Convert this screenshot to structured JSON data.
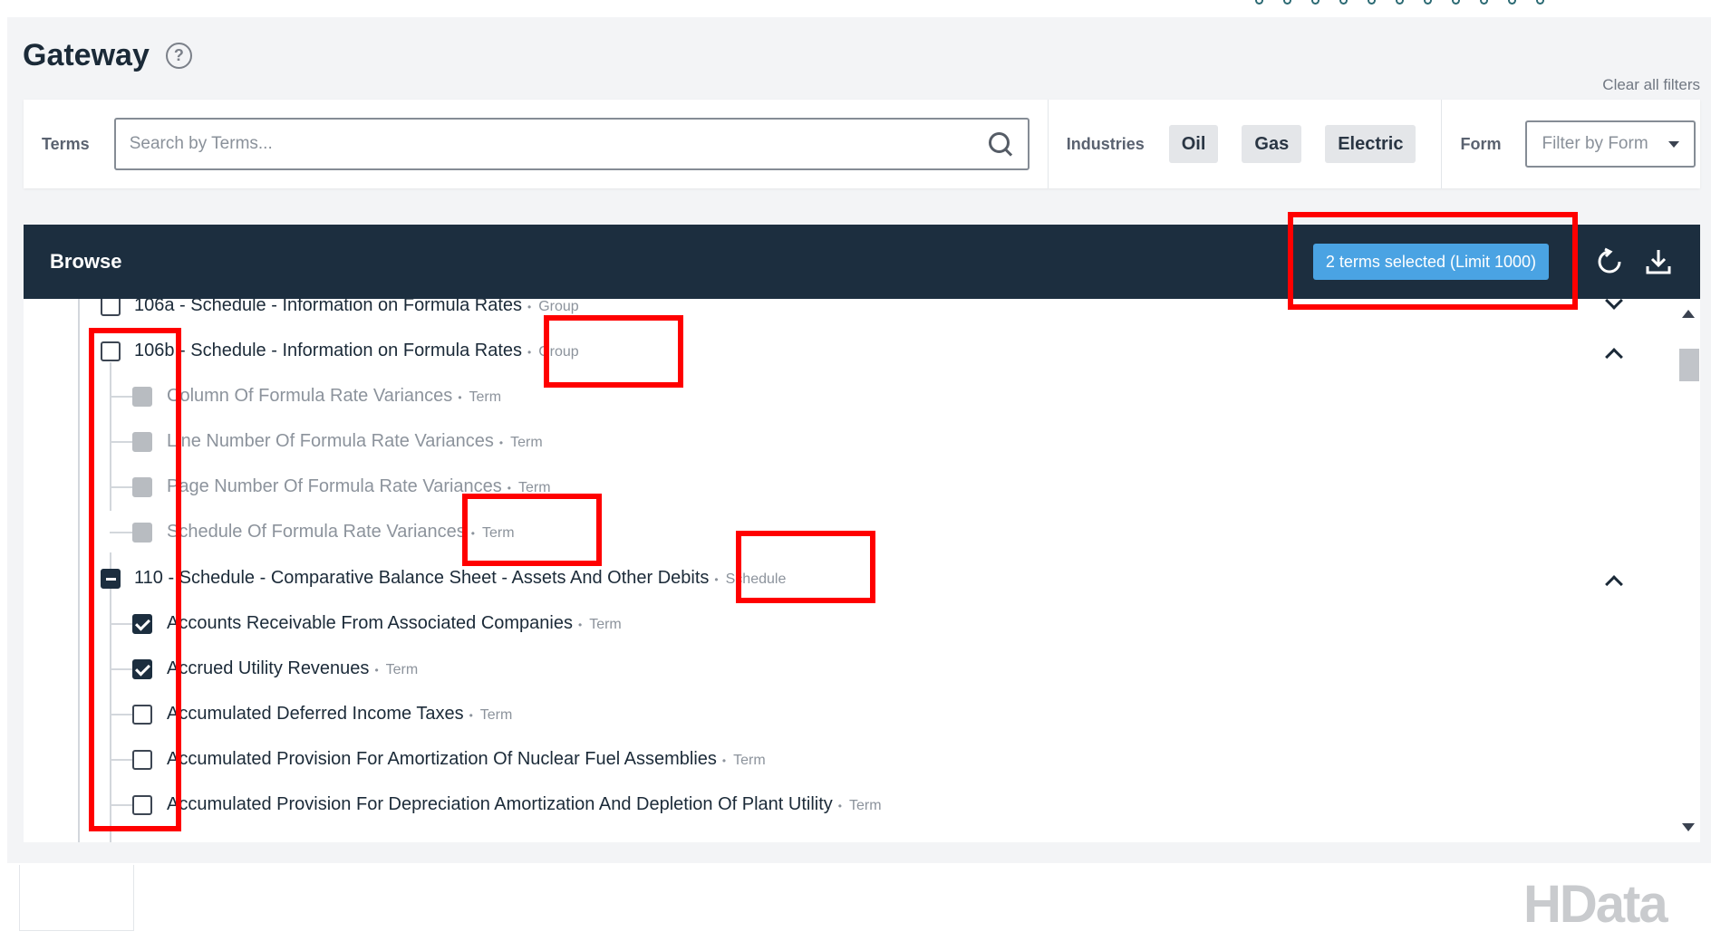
{
  "app": {
    "title": "Gateway",
    "clear_filters": "Clear all filters",
    "logo_text": "HData"
  },
  "filters": {
    "terms_label": "Terms",
    "search_placeholder": "Search by Terms...",
    "industries_label": "Industries",
    "industries": [
      "Oil",
      "Gas",
      "Electric"
    ],
    "form_label": "Form",
    "form_placeholder": "Filter by Form"
  },
  "browse": {
    "title": "Browse",
    "selected_text": "2 terms selected (Limit 1000)"
  },
  "tree": {
    "rows": [
      {
        "label": "106a - Schedule - Information on Formula Rates",
        "type": "Group",
        "state": "unchecked",
        "level": 0,
        "expand": "down"
      },
      {
        "label": "106b - Schedule - Information on Formula Rates",
        "type": "Group",
        "state": "unchecked",
        "level": 0,
        "expand": "up"
      },
      {
        "label": "Column Of Formula Rate Variances",
        "type": "Term",
        "state": "disabled",
        "level": 1
      },
      {
        "label": "Line Number Of Formula Rate Variances",
        "type": "Term",
        "state": "disabled",
        "level": 1
      },
      {
        "label": "Page Number Of Formula Rate Variances",
        "type": "Term",
        "state": "disabled",
        "level": 1
      },
      {
        "label": "Schedule Of Formula Rate Variances",
        "type": "Term",
        "state": "disabled",
        "level": 1
      },
      {
        "label": "110 - Schedule - Comparative Balance Sheet - Assets And Other Debits",
        "type": "Schedule",
        "state": "indeterminate",
        "level": 0,
        "expand": "up"
      },
      {
        "label": "Accounts Receivable From Associated Companies",
        "type": "Term",
        "state": "checked",
        "level": 1
      },
      {
        "label": "Accrued Utility Revenues",
        "type": "Term",
        "state": "checked",
        "level": 1
      },
      {
        "label": "Accumulated Deferred Income Taxes",
        "type": "Term",
        "state": "unchecked",
        "level": 1
      },
      {
        "label": "Accumulated Provision For Amortization Of Nuclear Fuel Assemblies",
        "type": "Term",
        "state": "unchecked",
        "level": 1
      },
      {
        "label": "Accumulated Provision For Depreciation Amortization And Depletion Of Plant Utility",
        "type": "Term",
        "state": "unchecked",
        "level": 1
      }
    ]
  },
  "icons": {
    "help": "help-icon",
    "search": "search-icon",
    "refresh": "refresh-icon",
    "download": "download-icon"
  },
  "colors": {
    "header_bg": "#1c2e3f",
    "badge_bg": "#4aa3e3",
    "annotation": "#ff0000"
  }
}
